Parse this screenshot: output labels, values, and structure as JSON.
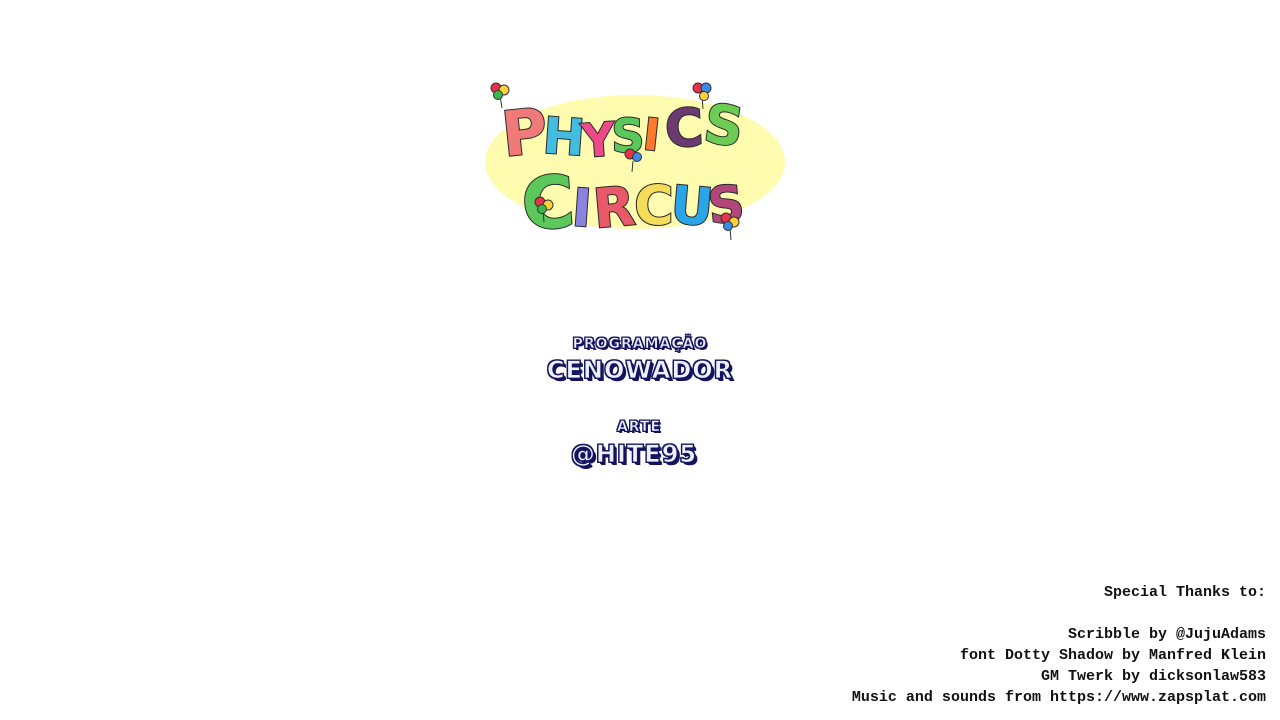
{
  "game": {
    "title_line1": "PHYSICS",
    "title_line2": "CIRCUS",
    "logo_colors": {
      "backdrop": "#fffcb0",
      "outline": "#2a2a2a",
      "letters": [
        "#f07a7a",
        "#42bde0",
        "#ee4a8a",
        "#5cc85c",
        "#ff7a2a",
        "#6b3a70",
        "#6ccc54",
        "#5cc85c",
        "#e85a6a",
        "#8a84e0",
        "#f5dc5a",
        "#2aa6e8",
        "#b0467a"
      ]
    }
  },
  "credits": [
    {
      "role": "PROGRAMAÇÃO",
      "name": "CENOWADOR"
    },
    {
      "role": "ARTE",
      "name": "@HITE95"
    }
  ],
  "thanks": {
    "heading": "Special Thanks to:",
    "lines": [
      "Scribble by @JujuAdams",
      "font Dotty Shadow by Manfred Klein",
      "GM Twerk by dicksonlaw583",
      "Music and sounds from https://www.zapsplat.com"
    ]
  },
  "colors": {
    "background": "#ffffff",
    "credit_fill": "#eef0ff",
    "credit_outline": "#14145e",
    "thanks_text": "#111111"
  }
}
